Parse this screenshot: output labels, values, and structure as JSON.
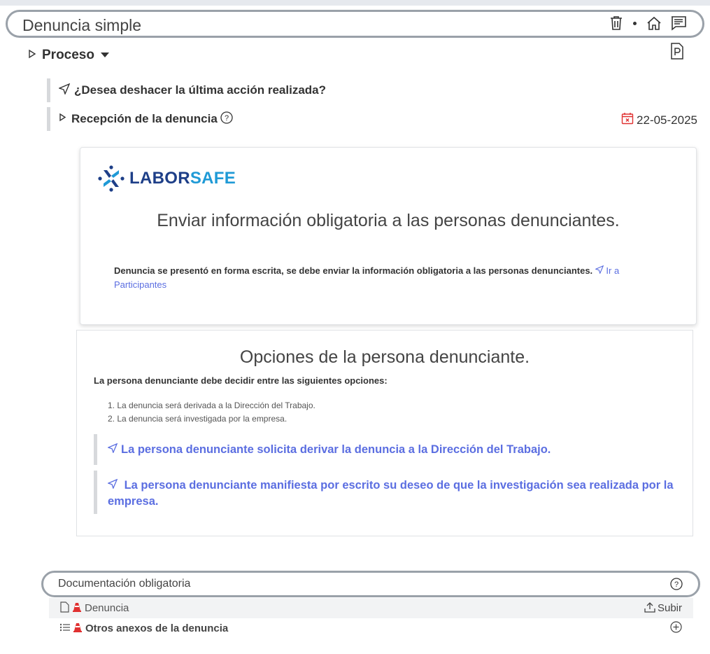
{
  "header": {
    "title": "Denuncia simple",
    "icons": [
      "trash-icon",
      "home-icon",
      "chat-icon"
    ]
  },
  "proceso": {
    "label": "Proceso"
  },
  "undo_question": "¿Desea deshacer la última acción realizada?",
  "recepcion": {
    "label": "Recepción de la denuncia",
    "date": "22-05-2025"
  },
  "card": {
    "logo_labor": "LABOR",
    "logo_safe": "SAFE",
    "title": "Enviar información obligatoria a las personas denunciantes.",
    "body": "Denuncia se presentó en forma escrita, se debe enviar la información obligatoria a las personas denunciantes.",
    "link": "Ir a Participantes"
  },
  "options": {
    "title": "Opciones de la persona denunciante.",
    "subtitle": "La persona denunciante debe decidir entre las siguientes opciones:",
    "items": [
      "1. La denuncia será derivada a la Dirección del Trabajo.",
      "2. La denuncia será investigada por la empresa."
    ],
    "action_1": "La persona denunciante solicita derivar la denuncia a la Dirección del Trabajo.",
    "action_2": "La persona denunciante manifiesta por escrito su deseo de que la investigación sea realizada por la empresa."
  },
  "documentation": {
    "title": "Documentación obligatoria",
    "rows": [
      {
        "label": "Denuncia",
        "action": "Subir"
      },
      {
        "label": "Otros anexos de la denuncia"
      }
    ]
  },
  "colors": {
    "link": "#5b6ee1",
    "logo_dark": "#1e3f88",
    "logo_light": "#1f9ad6",
    "alert": "#e03131"
  }
}
